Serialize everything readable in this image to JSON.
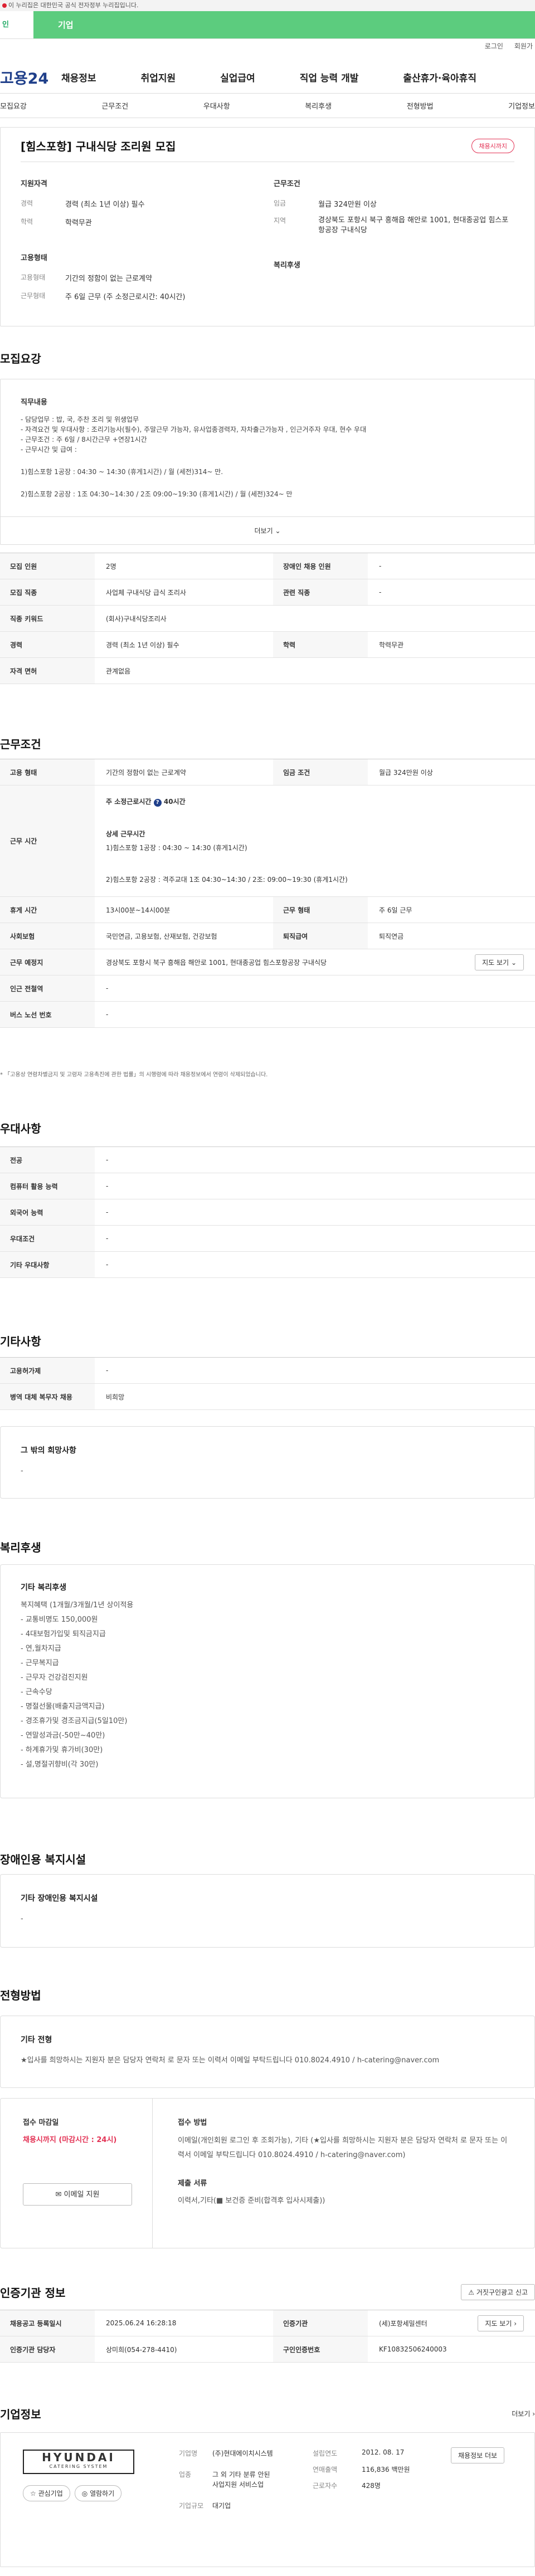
{
  "gov": {
    "text": "이 누리집은 대한민국 공식 전자정부 누리집입니다."
  },
  "tabs": [
    "인",
    "기업"
  ],
  "util": [
    "로그인",
    "회원가"
  ],
  "gnb": {
    "logo": "고용24",
    "menus": [
      "채용정보",
      "취업지원",
      "실업급여",
      "직업 능력 개발",
      "출산휴가·육아휴직"
    ]
  },
  "subnav": [
    "모집요강",
    "근무조건",
    "우대사항",
    "복리후생",
    "전형방법",
    "기업정보"
  ],
  "summary": {
    "title": "[힘스포항] 구내식당 조리원 모집",
    "badge": "채용시까지",
    "apply_label": "지원자격",
    "apply_items": [
      [
        "경력",
        "경력 (최소 1년 이상) 필수"
      ],
      [
        "학력",
        "학력무관"
      ]
    ],
    "work_label": "근무조건",
    "work_items": [
      [
        "임금",
        "월급 324만원 이상"
      ],
      [
        "지역",
        "경상북도 포항시 북구 흥해읍 해안로 1001, 현대종공업 힘스포항공장 구내식당"
      ]
    ],
    "emp_label": "고용형태",
    "emp_items": [
      [
        "고용형태",
        "기간의 정함이 없는 근로계약"
      ],
      [
        "근무형태",
        "주 6일 근무 (주 소정근로시간: 40시간)"
      ]
    ],
    "welfare_label": "복리후생"
  },
  "recruit": {
    "title": "모집요강",
    "box_title": "직무내용",
    "lines": [
      "- 담당업무 : 밥, 국, 주찬 조리 및 위생업무",
      "- 자격요건 및 우대사항 : 조리기능사(필수), 주말근무 가능자, 유사업종경력자, 자차출근가능자 , 인근거주자 우대, 현수 우대",
      "- 근무조건 : 주 6일 / 8시간근무 +연장1시간",
      "- 근무시간 및 급여 :",
      "1)힘스포항 1공장 : 04:30 ~ 14:30 (휴게1시간) / 월 (세전)314~ 만.",
      "2)힘스포항 2공장 : 1조 04:30~14:30 / 2조 09:00~19:30 (휴게1시간) / 월 (세전)324~ 만"
    ],
    "more": "더보기",
    "rows": [
      [
        "모집 인원",
        "2명",
        "장애인 채용 인원",
        "-"
      ],
      [
        "모집 직종",
        "사업체 구내식당 급식 조리사",
        "관련 직종",
        "-"
      ],
      [
        "직종 키워드",
        "(회사)구내식당조리사"
      ],
      [
        "경력",
        "경력 (최소 1년 이상) 필수",
        "학력",
        "학력무관"
      ],
      [
        "자격 면허",
        "관계없음"
      ]
    ]
  },
  "conditions": {
    "title": "근무조건",
    "type": [
      "고용 형태",
      "기간의 정함이 없는 근로계약",
      "임금 조건",
      "월급 324만원 이상"
    ],
    "time_label": "근무 시간",
    "time_main": "주 소정근로시간",
    "time_hours": "40시간",
    "time_detail_title": "상세 근무시간",
    "time_d1": "1)힘스포항 1공장 : 04:30 ~ 14:30 (휴게1시간)",
    "time_d2": "2)힘스포항 2공장 : 격주교대 1조 04:30~14:30 / 2조: 09:00~19:30 (휴게1시간)",
    "rows": [
      [
        "휴게 시간",
        "13시00분~14시00분",
        "근무 형태",
        "주 6일 근무"
      ],
      [
        "사회보험",
        "국민연금, 고용보험, 산재보험, 건강보험",
        "퇴직급여",
        "퇴직연금"
      ],
      [
        "근무 예정지",
        "경상북도 포항시 북구 흥해읍 해안로 1001, 현대종공업 힘스포항공장 구내식당"
      ],
      [
        "인근 전철역",
        "-"
      ],
      [
        "버스 노선 번호",
        "-"
      ]
    ],
    "map_btn": "지도 보기",
    "note": "* 「고용상 연령차별금지 및 고령자 고용촉진에 관한 법률」의 시행령에 따라 채용정보에서 연령이 삭제되었습니다."
  },
  "pref": {
    "title": "우대사항",
    "rows": [
      [
        "전공",
        "-"
      ],
      [
        "컴퓨터 활용 능력",
        "-"
      ],
      [
        "외국어 능력",
        "-"
      ],
      [
        "우대조건",
        "-"
      ],
      [
        "기타 우대사항",
        "-"
      ]
    ]
  },
  "etc": {
    "title": "기타사항",
    "rows": [
      [
        "고용허가제",
        "-"
      ],
      [
        "병역 대체 복무자 채용",
        "비희망"
      ]
    ],
    "box_title": "그 밖의 희망사항",
    "box_val": "-"
  },
  "welfare": {
    "title": "복리후생",
    "box_title": "기타 복리후생",
    "items": [
      "복지혜택 (1개월/3개월/1년 상이적용",
      "- 교통비명도 150,000원",
      "- 4대보험가입및 퇴직금지급",
      "- 연,월차지급",
      "- 근무복지급",
      "- 근무자 건강검진지원",
      "- 근속수당",
      "- 명절선물(배출지금액지급)",
      "- 경조휴가및 경조금지급(5일10만)",
      "- 연말성과금(-50만~40만)",
      "- 하계휴가및 휴가비(30만)",
      "- 설,명절귀향비(각 30만)"
    ]
  },
  "disabled": {
    "title": "장애인용 복지시설",
    "box_title": "기타 장애인용 복지시설",
    "box_val": "-"
  },
  "method": {
    "title": "전형방법",
    "box_title": "기타 전형",
    "box_text": "★입사를 희망하시는 지원자 분은 담당자 연락처 로 문자 또는 이력서 이메일 부탁드립니다 010.8024.4910 / h-catering@naver.com",
    "deadline_label": "접수 마감일",
    "deadline_val": "채용시까지 (마감시간 : 24시)",
    "email_btn": "이메일 지원",
    "method_label": "접수 방법",
    "method_text": "이메일(개인회원 로그인 후 조회가능), 기타 (★입사를 희망하시는 지원자 분은 담당자 연락처 로 문자 또는 이력서 이메일 부탁드립니다 010.8024.4910 / h-catering@naver.com)",
    "docs_label": "제출 서류",
    "docs_text": "이력서,기타(■ 보건증 준비(합격후 입사시제출))"
  },
  "agency": {
    "title": "인증기관 정보",
    "report_btn": "거짓구인광고 신고",
    "rows": [
      [
        "채용공고 등록일시",
        "2025.06.24 16:28:18",
        "인증기관",
        "(세)포항세밀센터"
      ],
      [
        "인증기관 담당자",
        "상미희(054-278-4410)",
        "구인인증번호",
        "KF10832506240003"
      ]
    ],
    "map_btn": "지도 보기"
  },
  "company": {
    "title": "기업정보",
    "more": "더보기",
    "logo_main": "HYUNDAI",
    "logo_sub": "CATERING SYSTEM",
    "btn1": "관심기업",
    "btn2": "열람하기",
    "rows": [
      [
        "기업명",
        "(주)현대에이치시스템",
        "설립연도",
        "2012. 08. 17"
      ],
      [
        "업종",
        "그 외 기타 분류 안된 사업지원 서비스업",
        "연매출액",
        "116,836 백만원"
      ],
      [
        "",
        "",
        "근로자수",
        "428명"
      ],
      [
        "기업규모",
        "대기업",
        "",
        ""
      ]
    ],
    "jobs_btn": "채용정보 더보"
  },
  "colors": {
    "green": "#5ccc7e",
    "navy": "#1f3f8a",
    "red": "#e33355"
  }
}
